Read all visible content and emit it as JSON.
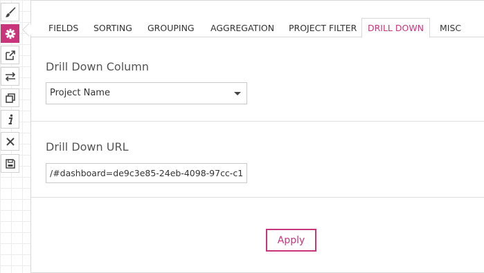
{
  "toolbar": {
    "items": [
      {
        "icon": "brush-icon"
      },
      {
        "icon": "gear-icon"
      },
      {
        "icon": "external-link-icon"
      },
      {
        "icon": "swap-icon"
      },
      {
        "icon": "copy-icon"
      },
      {
        "icon": "info-icon"
      },
      {
        "icon": "close-icon"
      },
      {
        "icon": "save-icon"
      }
    ],
    "active": "gear-icon"
  },
  "tabs": [
    "FIELDS",
    "SORTING",
    "GROUPING",
    "AGGREGATION",
    "PROJECT FILTER",
    "DRILL DOWN",
    "MISC"
  ],
  "active_tab": "DRILL DOWN",
  "drill_down_column": {
    "label": "Drill Down Column",
    "selected": "Project Name"
  },
  "drill_down_url": {
    "label": "Drill Down URL",
    "value": "/#dashboard=de9c3e85-24eb-4098-97cc-c1("
  },
  "apply_label": "Apply",
  "colors": {
    "accent": "#c8357a",
    "border": "#d8d8d8"
  }
}
